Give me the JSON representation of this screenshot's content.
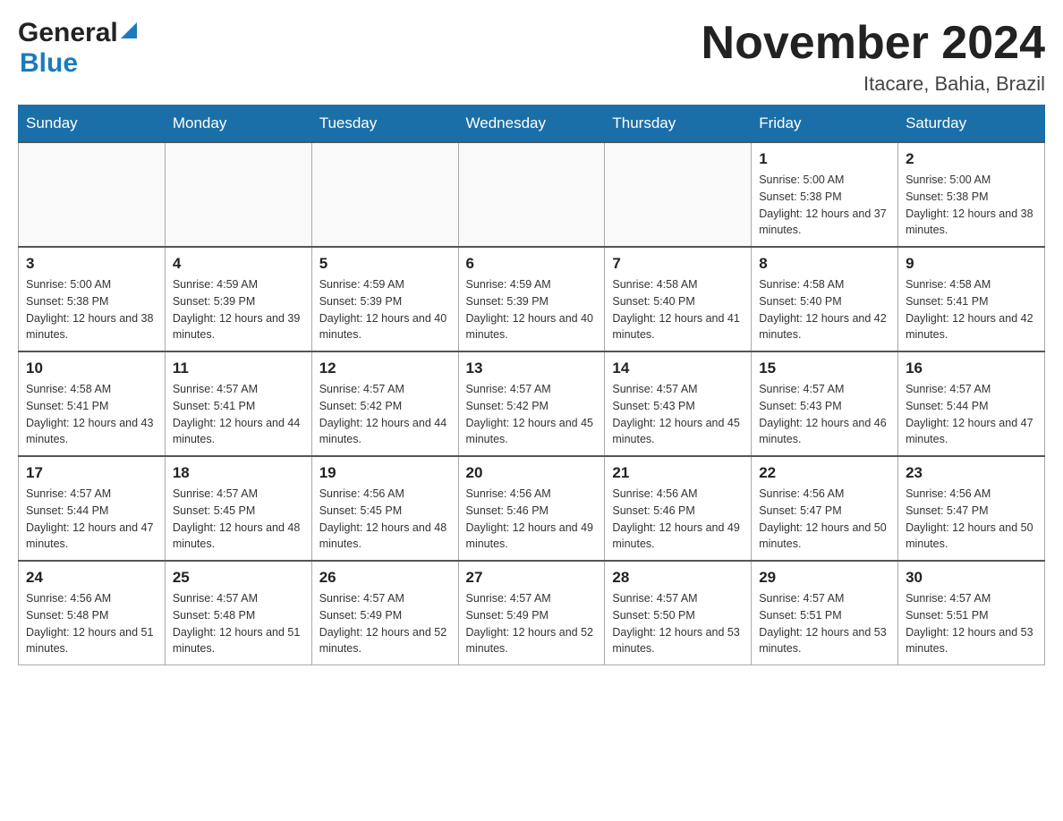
{
  "header": {
    "logo_general": "General",
    "logo_blue": "Blue",
    "title": "November 2024",
    "location": "Itacare, Bahia, Brazil"
  },
  "days_of_week": [
    "Sunday",
    "Monday",
    "Tuesday",
    "Wednesday",
    "Thursday",
    "Friday",
    "Saturday"
  ],
  "weeks": [
    [
      {
        "day": "",
        "sunrise": "",
        "sunset": "",
        "daylight": ""
      },
      {
        "day": "",
        "sunrise": "",
        "sunset": "",
        "daylight": ""
      },
      {
        "day": "",
        "sunrise": "",
        "sunset": "",
        "daylight": ""
      },
      {
        "day": "",
        "sunrise": "",
        "sunset": "",
        "daylight": ""
      },
      {
        "day": "",
        "sunrise": "",
        "sunset": "",
        "daylight": ""
      },
      {
        "day": "1",
        "sunrise": "Sunrise: 5:00 AM",
        "sunset": "Sunset: 5:38 PM",
        "daylight": "Daylight: 12 hours and 37 minutes."
      },
      {
        "day": "2",
        "sunrise": "Sunrise: 5:00 AM",
        "sunset": "Sunset: 5:38 PM",
        "daylight": "Daylight: 12 hours and 38 minutes."
      }
    ],
    [
      {
        "day": "3",
        "sunrise": "Sunrise: 5:00 AM",
        "sunset": "Sunset: 5:38 PM",
        "daylight": "Daylight: 12 hours and 38 minutes."
      },
      {
        "day": "4",
        "sunrise": "Sunrise: 4:59 AM",
        "sunset": "Sunset: 5:39 PM",
        "daylight": "Daylight: 12 hours and 39 minutes."
      },
      {
        "day": "5",
        "sunrise": "Sunrise: 4:59 AM",
        "sunset": "Sunset: 5:39 PM",
        "daylight": "Daylight: 12 hours and 40 minutes."
      },
      {
        "day": "6",
        "sunrise": "Sunrise: 4:59 AM",
        "sunset": "Sunset: 5:39 PM",
        "daylight": "Daylight: 12 hours and 40 minutes."
      },
      {
        "day": "7",
        "sunrise": "Sunrise: 4:58 AM",
        "sunset": "Sunset: 5:40 PM",
        "daylight": "Daylight: 12 hours and 41 minutes."
      },
      {
        "day": "8",
        "sunrise": "Sunrise: 4:58 AM",
        "sunset": "Sunset: 5:40 PM",
        "daylight": "Daylight: 12 hours and 42 minutes."
      },
      {
        "day": "9",
        "sunrise": "Sunrise: 4:58 AM",
        "sunset": "Sunset: 5:41 PM",
        "daylight": "Daylight: 12 hours and 42 minutes."
      }
    ],
    [
      {
        "day": "10",
        "sunrise": "Sunrise: 4:58 AM",
        "sunset": "Sunset: 5:41 PM",
        "daylight": "Daylight: 12 hours and 43 minutes."
      },
      {
        "day": "11",
        "sunrise": "Sunrise: 4:57 AM",
        "sunset": "Sunset: 5:41 PM",
        "daylight": "Daylight: 12 hours and 44 minutes."
      },
      {
        "day": "12",
        "sunrise": "Sunrise: 4:57 AM",
        "sunset": "Sunset: 5:42 PM",
        "daylight": "Daylight: 12 hours and 44 minutes."
      },
      {
        "day": "13",
        "sunrise": "Sunrise: 4:57 AM",
        "sunset": "Sunset: 5:42 PM",
        "daylight": "Daylight: 12 hours and 45 minutes."
      },
      {
        "day": "14",
        "sunrise": "Sunrise: 4:57 AM",
        "sunset": "Sunset: 5:43 PM",
        "daylight": "Daylight: 12 hours and 45 minutes."
      },
      {
        "day": "15",
        "sunrise": "Sunrise: 4:57 AM",
        "sunset": "Sunset: 5:43 PM",
        "daylight": "Daylight: 12 hours and 46 minutes."
      },
      {
        "day": "16",
        "sunrise": "Sunrise: 4:57 AM",
        "sunset": "Sunset: 5:44 PM",
        "daylight": "Daylight: 12 hours and 47 minutes."
      }
    ],
    [
      {
        "day": "17",
        "sunrise": "Sunrise: 4:57 AM",
        "sunset": "Sunset: 5:44 PM",
        "daylight": "Daylight: 12 hours and 47 minutes."
      },
      {
        "day": "18",
        "sunrise": "Sunrise: 4:57 AM",
        "sunset": "Sunset: 5:45 PM",
        "daylight": "Daylight: 12 hours and 48 minutes."
      },
      {
        "day": "19",
        "sunrise": "Sunrise: 4:56 AM",
        "sunset": "Sunset: 5:45 PM",
        "daylight": "Daylight: 12 hours and 48 minutes."
      },
      {
        "day": "20",
        "sunrise": "Sunrise: 4:56 AM",
        "sunset": "Sunset: 5:46 PM",
        "daylight": "Daylight: 12 hours and 49 minutes."
      },
      {
        "day": "21",
        "sunrise": "Sunrise: 4:56 AM",
        "sunset": "Sunset: 5:46 PM",
        "daylight": "Daylight: 12 hours and 49 minutes."
      },
      {
        "day": "22",
        "sunrise": "Sunrise: 4:56 AM",
        "sunset": "Sunset: 5:47 PM",
        "daylight": "Daylight: 12 hours and 50 minutes."
      },
      {
        "day": "23",
        "sunrise": "Sunrise: 4:56 AM",
        "sunset": "Sunset: 5:47 PM",
        "daylight": "Daylight: 12 hours and 50 minutes."
      }
    ],
    [
      {
        "day": "24",
        "sunrise": "Sunrise: 4:56 AM",
        "sunset": "Sunset: 5:48 PM",
        "daylight": "Daylight: 12 hours and 51 minutes."
      },
      {
        "day": "25",
        "sunrise": "Sunrise: 4:57 AM",
        "sunset": "Sunset: 5:48 PM",
        "daylight": "Daylight: 12 hours and 51 minutes."
      },
      {
        "day": "26",
        "sunrise": "Sunrise: 4:57 AM",
        "sunset": "Sunset: 5:49 PM",
        "daylight": "Daylight: 12 hours and 52 minutes."
      },
      {
        "day": "27",
        "sunrise": "Sunrise: 4:57 AM",
        "sunset": "Sunset: 5:49 PM",
        "daylight": "Daylight: 12 hours and 52 minutes."
      },
      {
        "day": "28",
        "sunrise": "Sunrise: 4:57 AM",
        "sunset": "Sunset: 5:50 PM",
        "daylight": "Daylight: 12 hours and 53 minutes."
      },
      {
        "day": "29",
        "sunrise": "Sunrise: 4:57 AM",
        "sunset": "Sunset: 5:51 PM",
        "daylight": "Daylight: 12 hours and 53 minutes."
      },
      {
        "day": "30",
        "sunrise": "Sunrise: 4:57 AM",
        "sunset": "Sunset: 5:51 PM",
        "daylight": "Daylight: 12 hours and 53 minutes."
      }
    ]
  ]
}
